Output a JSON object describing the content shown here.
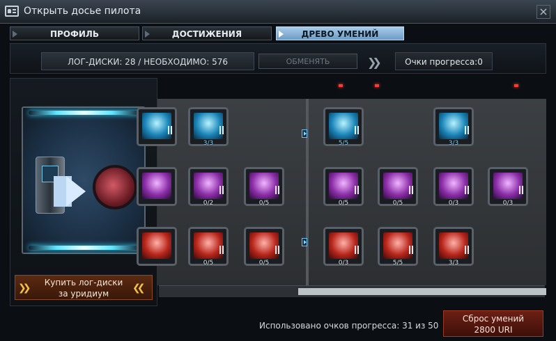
{
  "window": {
    "title": "Открыть досье пилота",
    "close_glyph": "×"
  },
  "tabs": [
    {
      "label": "ПРОФИЛЬ",
      "active": false
    },
    {
      "label": "ДОСТИЖЕНИЯ",
      "active": false
    },
    {
      "label": "ДРЕВО УМЕНИЙ",
      "active": true
    }
  ],
  "infobar": {
    "log_disks": "ЛОГ-ДИСКИ: 28 / НЕОБХОДИМО: 576",
    "exchange_label": "ОБМЕНЯТЬ",
    "progress_points": "Очки прогресса:0"
  },
  "left_panel": {
    "buy_line1": "Купить лог-диски",
    "buy_line2": "за уридиум",
    "arrows": "❯❯"
  },
  "skills": {
    "left": [
      {
        "level": "",
        "color": "blue",
        "icon": "laser-icon"
      },
      {
        "level": "3/3",
        "color": "blue",
        "icon": "ammo-box-icon"
      },
      {
        "level": "",
        "color": "purple",
        "icon": "dice-icon"
      },
      {
        "level": "0/2",
        "color": "purple",
        "icon": "fist-icon"
      },
      {
        "level": "0/5",
        "color": "purple",
        "icon": "rocket-icon"
      },
      {
        "level": "",
        "color": "red",
        "icon": "skull-icon"
      },
      {
        "level": "0/5",
        "color": "red",
        "icon": "rifle-icon"
      },
      {
        "level": "0/5",
        "color": "red",
        "icon": "missile-icon"
      }
    ],
    "right": [
      {
        "level": "5/5",
        "color": "blue",
        "icon": "ship-laser-icon"
      },
      {
        "level": "3/3",
        "color": "blue",
        "icon": "ship-icon"
      },
      {
        "level": "0/5",
        "color": "purple",
        "icon": "hand-icon"
      },
      {
        "level": "0/5",
        "color": "purple",
        "icon": "rocket-icon"
      },
      {
        "level": "0/3",
        "color": "purple",
        "icon": "fist-icon"
      },
      {
        "level": "0/3",
        "color": "purple",
        "icon": "dice-icon"
      },
      {
        "level": "0/3",
        "color": "red",
        "icon": "skull-icon"
      },
      {
        "level": "5/5",
        "color": "red",
        "icon": "fighter-icon"
      },
      {
        "level": "3/3",
        "color": "red",
        "icon": "wounded-head-icon"
      }
    ]
  },
  "footer": {
    "used_points": "Использовано очков прогресса: 31 из 50",
    "reset_line1": "Сброс умений",
    "reset_line2": "2800 URI"
  },
  "colors": {
    "accent_tab": "#8fb8dc",
    "reset_button": "#5a1a10",
    "buy_button": "#4a200c"
  }
}
